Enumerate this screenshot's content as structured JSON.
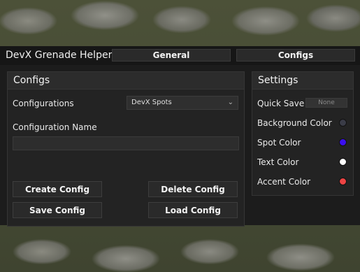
{
  "window": {
    "title": "DevX Grenade Helper",
    "tabs": [
      {
        "label": "General"
      },
      {
        "label": "Configs"
      }
    ]
  },
  "configs": {
    "header": "Configs",
    "configurations_label": "Configurations",
    "selected_config": "DevX Spots",
    "name_label": "Configuration Name",
    "name_value": "",
    "buttons": {
      "create": "Create Config",
      "delete": "Delete Config",
      "save": "Save Config",
      "load": "Load Config"
    }
  },
  "settings": {
    "header": "Settings",
    "quick_save_label": "Quick Save",
    "quick_save_value": "None",
    "colors": [
      {
        "label": "Background Color",
        "hex": "#3a3c47"
      },
      {
        "label": "Spot Color",
        "hex": "#3b0ff0"
      },
      {
        "label": "Text Color",
        "hex": "#ffffff"
      },
      {
        "label": "Accent Color",
        "hex": "#ee4444"
      }
    ]
  }
}
